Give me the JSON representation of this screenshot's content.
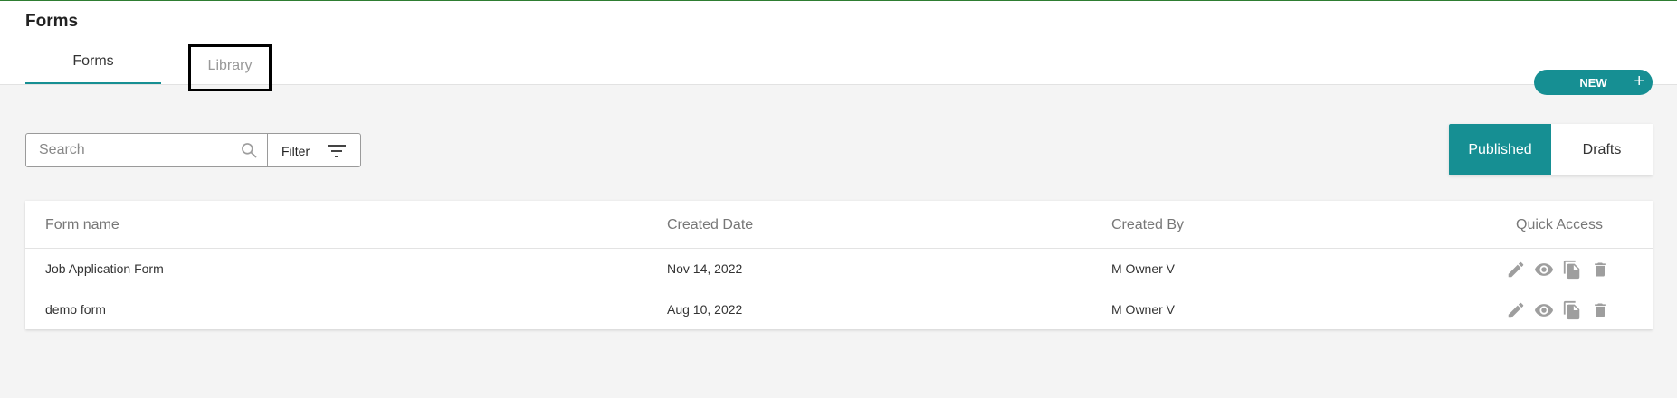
{
  "page": {
    "title": "Forms"
  },
  "tabs": [
    {
      "label": "Forms",
      "active": true
    },
    {
      "label": "Library",
      "active": false
    }
  ],
  "new_button": {
    "label": "NEW",
    "icon": "plus-icon"
  },
  "search": {
    "placeholder": "Search",
    "value": "",
    "icon": "search-icon"
  },
  "filter": {
    "label": "Filter",
    "icon": "filter-icon"
  },
  "toggle": {
    "published": "Published",
    "drafts": "Drafts",
    "selected": "Published"
  },
  "table": {
    "headers": [
      "Form name",
      "Created Date",
      "Created By",
      "Quick Access"
    ],
    "rows": [
      {
        "name": "Job Application Form",
        "date": "Nov 14, 2022",
        "by": "M Owner V"
      },
      {
        "name": "demo form",
        "date": "Aug 10, 2022",
        "by": "M Owner V"
      }
    ],
    "actions": [
      "edit-icon",
      "view-icon",
      "copy-icon",
      "delete-icon"
    ]
  },
  "colors": {
    "accent": "#168f93",
    "top_line": "#2e7d32",
    "background": "#f4f4f4",
    "icon_gray": "#9e9e9e"
  }
}
